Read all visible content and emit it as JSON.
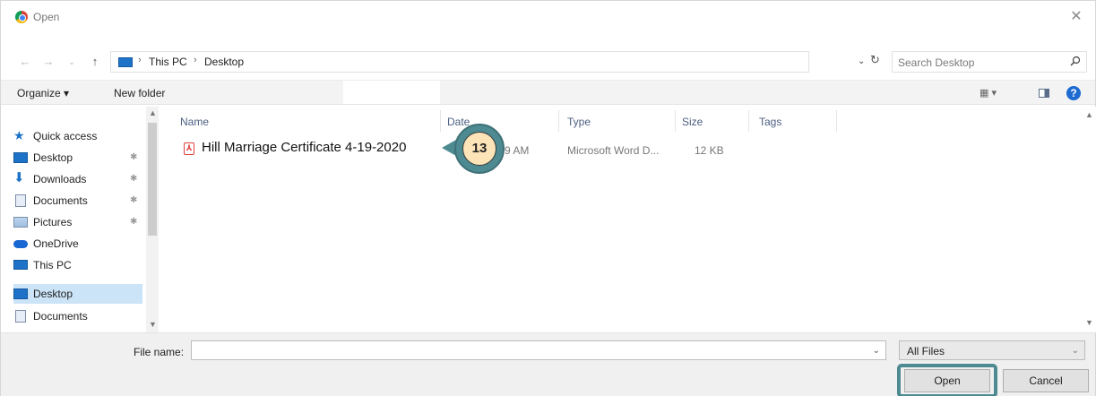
{
  "window": {
    "title": "Open",
    "close_glyph": "✕"
  },
  "address": {
    "breadcrumbs": [
      "This PC",
      "Desktop"
    ],
    "separator": "›",
    "search_placeholder": "Search Desktop"
  },
  "toolbar": {
    "organize_label": "Organize ▾",
    "new_folder_label": "New folder",
    "help_label": "?"
  },
  "nav": {
    "items": [
      {
        "label": "Quick access",
        "icon": "star-icon",
        "pinned": false
      },
      {
        "label": "Desktop",
        "icon": "desktop-icon",
        "pinned": true
      },
      {
        "label": "Downloads",
        "icon": "download-icon",
        "pinned": true
      },
      {
        "label": "Documents",
        "icon": "documents-icon",
        "pinned": true
      },
      {
        "label": "Pictures",
        "icon": "pictures-icon",
        "pinned": true
      },
      {
        "label": "OneDrive",
        "icon": "onedrive-icon",
        "pinned": false
      },
      {
        "label": "This PC",
        "icon": "this-pc-icon",
        "pinned": false
      },
      {
        "label": "Desktop",
        "icon": "desktop-icon",
        "selected": true
      },
      {
        "label": "Documents",
        "icon": "documents-icon",
        "pinned": false
      }
    ],
    "pin_glyph": "✱"
  },
  "files": {
    "columns": [
      "Name",
      "Date",
      "Type",
      "Size",
      "Tags"
    ],
    "rows": [
      {
        "name": "Hill Marriage Certificate 4-19-2020",
        "date": ":59 AM",
        "type": "Microsoft Word D...",
        "size": "12 KB"
      }
    ]
  },
  "step_badge": "13",
  "bottom": {
    "file_name_label": "File name:",
    "file_name_value": "",
    "filter_label": "All Files",
    "open_label": "Open",
    "cancel_label": "Cancel"
  },
  "colors": {
    "accent": "#4e8a91",
    "selection": "#cce4f7",
    "badge_fill": "#fce4b8"
  }
}
